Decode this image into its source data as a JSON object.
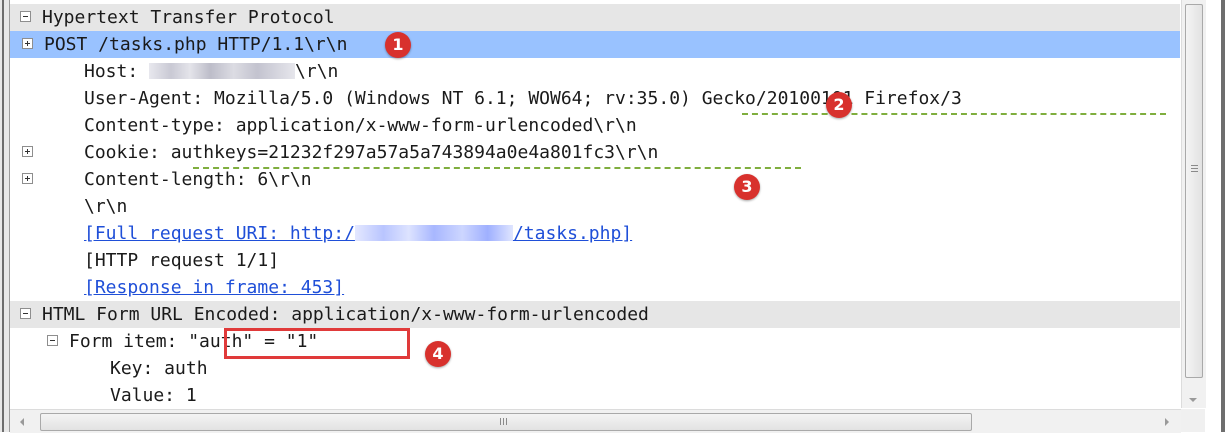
{
  "tree": {
    "rows": [
      {
        "text": "Hypertext Transfer Protocol"
      },
      {
        "text": "POST /tasks.php HTTP/1.1\\r\\n"
      },
      {
        "label": "Host: ",
        "suffix": "\\r\\n"
      },
      {
        "text": "User-Agent: Mozilla/5.0 (Windows NT 6.1; WOW64; rv:35.0) Gecko/20100101 Firefox/3"
      },
      {
        "text": "Content-type: application/x-www-form-urlencoded\\r\\n"
      },
      {
        "label": "Cookie: ",
        "value": "authkeys=21232f297a57a5a743894a0e4a801fc3\\r\\n"
      },
      {
        "text": "Content-length: 6\\r\\n"
      },
      {
        "text": "\\r\\n"
      },
      {
        "prefix": "[Full request URI: http:/",
        "suffix": "/tasks.php]"
      },
      {
        "text": "[HTTP request 1/1]"
      },
      {
        "text": "[Response in frame: 453]"
      },
      {
        "text": "HTML Form URL Encoded: application/x-www-form-urlencoded"
      },
      {
        "label": "Form item: ",
        "value": "\"auth\" = \"1\""
      },
      {
        "text": "Key: auth"
      },
      {
        "text": "Value: 1"
      }
    ]
  },
  "annotations": [
    "1",
    "2",
    "3",
    "4"
  ],
  "colors": {
    "selection": "#99c2ff",
    "section_bg": "#e6e6e6",
    "link": "#1f4fd8",
    "badge": "#d8312d",
    "highlight_box": "#e03a3a",
    "dash_underline": "#7fae3e"
  }
}
